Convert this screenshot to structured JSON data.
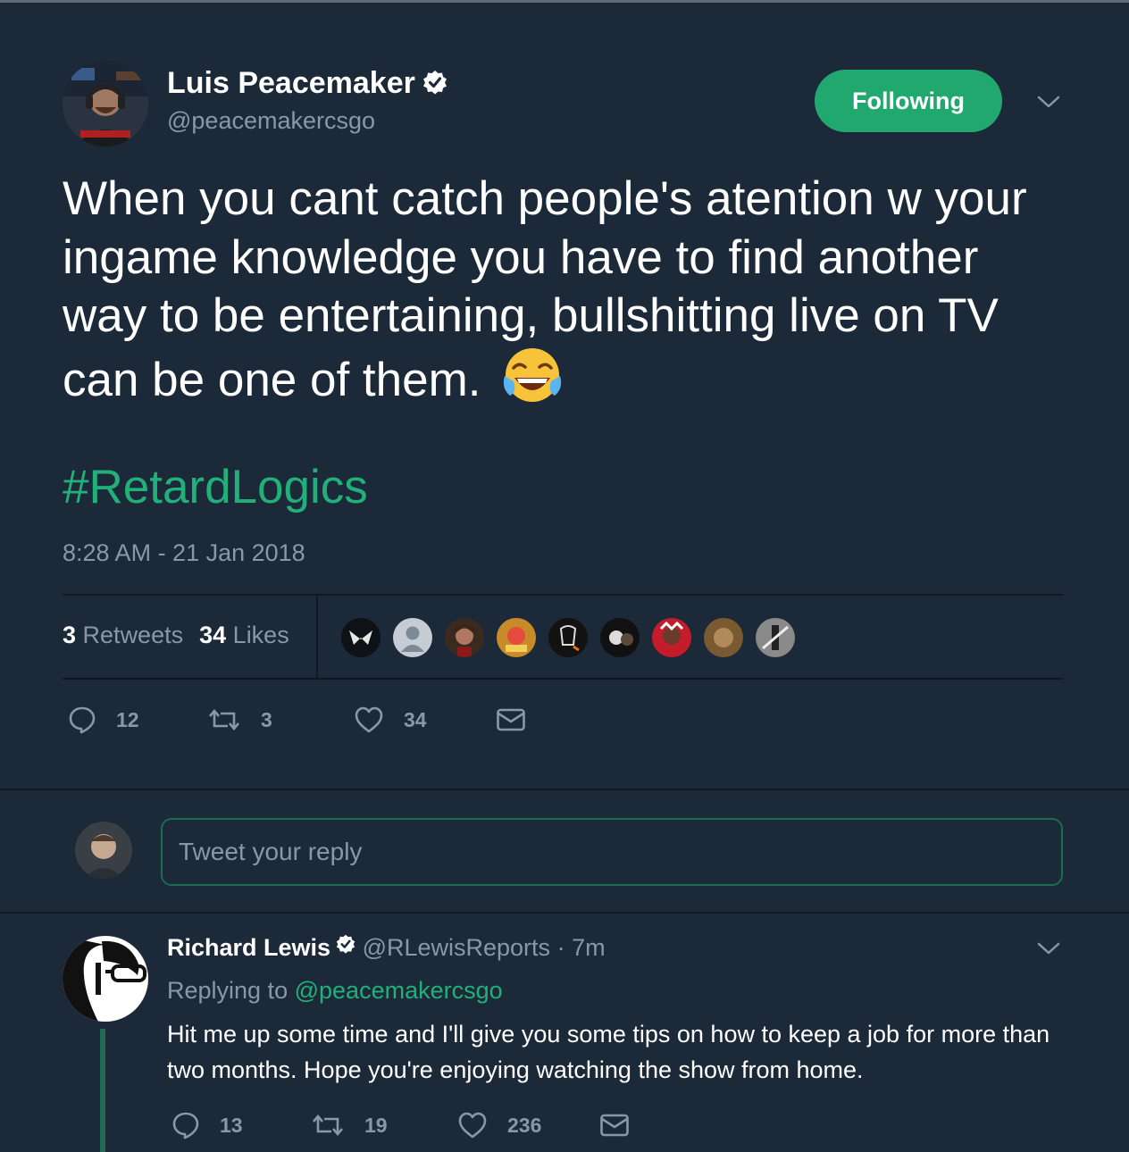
{
  "tweet": {
    "author_name": "Luis Peacemaker",
    "author_handle": "@peacemakercsgo",
    "follow_label": "Following",
    "text": "When you cant catch people's atention w your ingame knowledge you have to find another way to be entertaining, bullshitting live on TV can be one of them.",
    "emoji": "face-with-tears-of-joy",
    "hashtag": "#RetardLogics",
    "timestamp": "8:28 AM - 21 Jan 2018",
    "retweets_count": "3",
    "retweets_label": "Retweets",
    "likes_count": "34",
    "likes_label": "Likes",
    "liker_avatars": 9,
    "actions": {
      "replies": "12",
      "retweets": "3",
      "likes": "34"
    }
  },
  "reply_composer": {
    "placeholder": "Tweet your reply"
  },
  "reply": {
    "author_name": "Richard Lewis",
    "author_handle": "@RLewisReports",
    "time": "· 7m",
    "replying_prefix": "Replying to",
    "replying_to": "@peacemakercsgo",
    "text": "Hit me up some time and I'll give you some tips on how to keep a job for more than two months. Hope you're enjoying watching the show from home.",
    "actions": {
      "replies": "13",
      "retweets": "19",
      "likes": "236"
    }
  },
  "colors": {
    "background": "#1c2938",
    "accent_green": "#21a86e",
    "muted": "#8899a6",
    "divider": "#101820"
  }
}
